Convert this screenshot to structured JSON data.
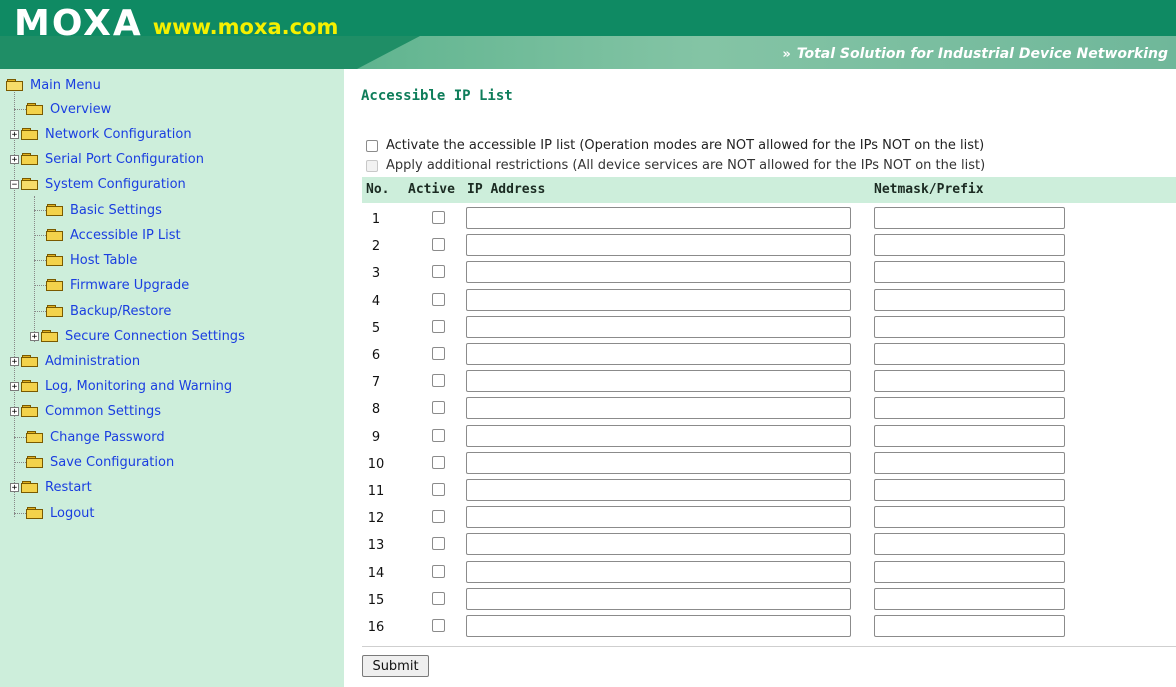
{
  "brand": {
    "logo_text": "MOXA",
    "url": "www.moxa.com",
    "tagline": "Total Solution for Industrial Device Networking"
  },
  "sidebar": {
    "root": "Main Menu",
    "items": [
      {
        "label": "Overview"
      },
      {
        "label": "Network Configuration"
      },
      {
        "label": "Serial Port Configuration"
      },
      {
        "label": "System Configuration"
      },
      {
        "label": "Basic Settings"
      },
      {
        "label": "Accessible IP List"
      },
      {
        "label": "Host Table"
      },
      {
        "label": "Firmware Upgrade"
      },
      {
        "label": "Backup/Restore"
      },
      {
        "label": "Secure Connection Settings"
      },
      {
        "label": "Administration"
      },
      {
        "label": "Log, Monitoring and Warning"
      },
      {
        "label": "Common Settings"
      },
      {
        "label": "Change Password"
      },
      {
        "label": "Save Configuration"
      },
      {
        "label": "Restart"
      },
      {
        "label": "Logout"
      }
    ]
  },
  "main": {
    "title": "Accessible IP List",
    "activate_label": "Activate the accessible IP list (Operation modes are NOT allowed for the IPs NOT on the list)",
    "restrict_label": "Apply additional restrictions (All device services are NOT allowed for the IPs NOT on the list)",
    "columns": {
      "no": "No.",
      "active": "Active",
      "ip": "IP Address",
      "netmask": "Netmask/Prefix"
    },
    "rows": [
      {
        "no": "1"
      },
      {
        "no": "2"
      },
      {
        "no": "3"
      },
      {
        "no": "4"
      },
      {
        "no": "5"
      },
      {
        "no": "6"
      },
      {
        "no": "7"
      },
      {
        "no": "8"
      },
      {
        "no": "9"
      },
      {
        "no": "10"
      },
      {
        "no": "11"
      },
      {
        "no": "12"
      },
      {
        "no": "13"
      },
      {
        "no": "14"
      },
      {
        "no": "15"
      },
      {
        "no": "16"
      }
    ],
    "submit_label": "Submit"
  },
  "colors": {
    "header_green": "#0f8a63",
    "sidebar_bg": "#cdeedb",
    "link_blue": "#1a3ee0",
    "title_green": "#0e7d5a",
    "url_yellow": "#f5f000"
  }
}
